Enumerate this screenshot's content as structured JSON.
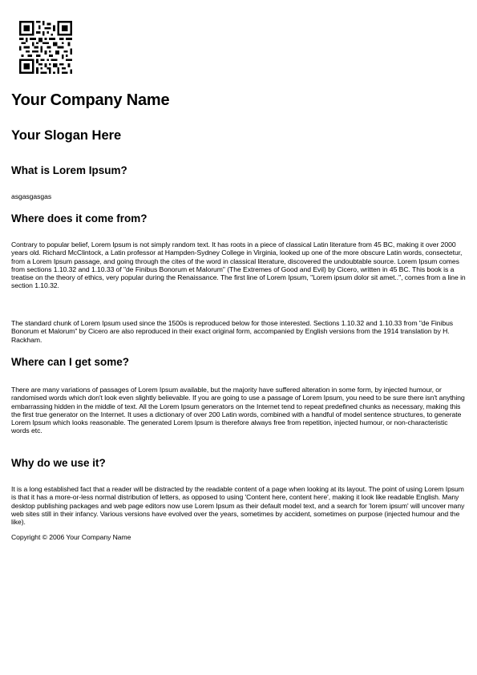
{
  "header": {
    "qr_code": "qr-code",
    "company_name": "Your Company Name",
    "slogan": "Your Slogan Here"
  },
  "sections": [
    {
      "heading": "What is Lorem Ipsum?",
      "paragraphs": [
        "asgasgasgas"
      ]
    },
    {
      "heading": "Where does it come from?",
      "paragraphs": [
        "Contrary to popular belief, Lorem Ipsum is not simply random text. It has roots in a piece of classical Latin literature from 45 BC, making it over 2000 years old. Richard McClintock, a Latin professor at Hampden-Sydney College in Virginia, looked up one of the more obscure Latin words, consectetur, from a Lorem Ipsum passage, and going through the cites of the word in classical literature, discovered the undoubtable source. Lorem Ipsum comes from sections 1.10.32 and 1.10.33 of \"de Finibus Bonorum et Malorum\" (The Extremes of Good and Evil) by Cicero, written in 45 BC. This book is a treatise on the theory of ethics, very popular during the Renaissance. The first line of Lorem Ipsum, \"Lorem ipsum dolor sit amet..\", comes from a line in section 1.10.32.",
        "The standard chunk of Lorem Ipsum used since the 1500s is reproduced below for those interested. Sections 1.10.32 and 1.10.33 from \"de Finibus Bonorum et Malorum\" by Cicero are also reproduced in their exact original form, accompanied by English versions from the 1914 translation by H. Rackham."
      ]
    },
    {
      "heading": "Where can I get some?",
      "paragraphs": [
        "There are many variations of passages of Lorem Ipsum available, but the majority have suffered alteration in some form, by injected humour, or randomised words which don't look even slightly believable. If you are going to use a passage of Lorem Ipsum, you need to be sure there isn't anything embarrassing hidden in the middle of text. All the Lorem Ipsum generators on the Internet tend to repeat predefined chunks as necessary, making this the first true generator on the Internet. It uses a dictionary of over 200 Latin words, combined with a handful of model sentence structures, to generate Lorem Ipsum which looks reasonable. The generated Lorem Ipsum is therefore always free from repetition, injected humour, or non-characteristic words etc."
      ]
    },
    {
      "heading": "Why do we use it?",
      "paragraphs": [
        "It is a long established fact that a reader will be distracted by the readable content of a page when looking at its layout. The point of using Lorem Ipsum is that it has a more-or-less normal distribution of letters, as opposed to using 'Content here, content here', making it look like readable English. Many desktop publishing packages and web page editors now use Lorem Ipsum as their default model text, and a search for 'lorem ipsum' will uncover many web sites still in their infancy. Various versions have evolved over the years, sometimes by accident, sometimes on purpose (injected humour and the like)."
      ]
    }
  ],
  "footer": {
    "copyright": "Copyright © 2006 Your Company Name"
  }
}
